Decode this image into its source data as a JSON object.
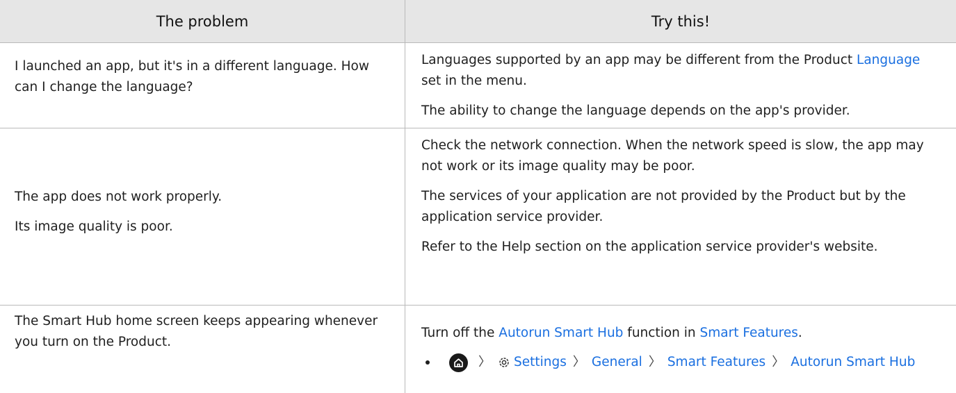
{
  "header": {
    "col1": "The problem",
    "col2": "Try this!"
  },
  "rows": [
    {
      "problem": [
        "I launched an app, but it's in a different language. How can I change the language?"
      ],
      "solution": {
        "p1_text": "Languages supported by an app may be different from the Product ",
        "p1_link": "Language",
        "p1_tail": " set in the menu.",
        "p2": "The ability to change the language depends on the app's provider."
      }
    },
    {
      "problem": [
        "The app does not work properly.",
        "Its image quality is poor."
      ],
      "solution": {
        "p1": "Check the network connection. When the network speed is slow, the app may not work or its image quality may be poor.",
        "p2": "The services of your application are not provided by the Product but by the application service provider.",
        "p3": "Refer to the Help section on the application service provider's website."
      }
    },
    {
      "problem": [
        "The Smart Hub home screen keeps appearing whenever you turn on the Product."
      ],
      "solution": {
        "p1_a": "Turn off the ",
        "p1_link1": "Autorun Smart Hub",
        "p1_b": " function in ",
        "p1_link2": "Smart Features",
        "p1_c": ".",
        "path": [
          "Settings",
          "General",
          "Smart Features",
          "Autorun Smart Hub"
        ]
      }
    }
  ],
  "icons": {
    "home": "home-icon",
    "settings": "gear-icon",
    "separator": "chevron-right-icon"
  },
  "colors": {
    "header_bg": "#e6e6e6",
    "link": "#1a6fe0",
    "border": "#b9b9b9"
  }
}
